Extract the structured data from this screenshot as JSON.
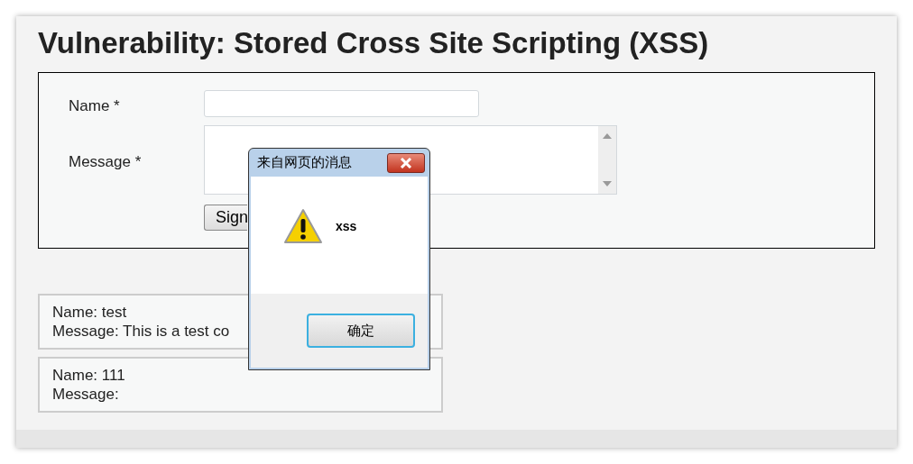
{
  "page": {
    "heading": "Vulnerability: Stored Cross Site Scripting (XSS)"
  },
  "form": {
    "fields": [
      {
        "label": "Name *",
        "kind": "input"
      },
      {
        "label": "Message *",
        "kind": "textarea"
      }
    ],
    "submit": "Sign"
  },
  "comments": [
    {
      "lines": [
        "Name: test",
        "Message: This is a test co"
      ]
    },
    {
      "lines": [
        "Name: 111",
        "Message:"
      ]
    }
  ],
  "dialog": {
    "title": "来自网页的消息",
    "message": "xss",
    "button": "确定"
  }
}
